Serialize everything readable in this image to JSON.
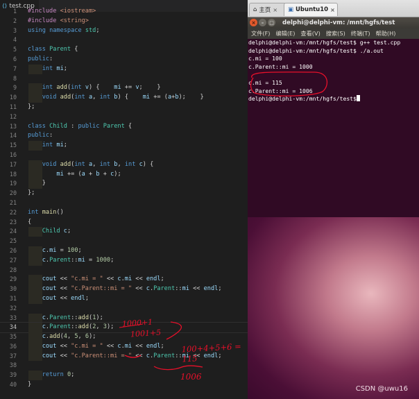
{
  "editor": {
    "tab_label": "test.cpp",
    "tab_icon": "cpp-file-icon",
    "current_line": 34,
    "lines": [
      {
        "n": "1",
        "t": "#include <iostream>"
      },
      {
        "n": "2",
        "t": "#include <string>"
      },
      {
        "n": "3",
        "t": "using namespace std;"
      },
      {
        "n": "4",
        "t": ""
      },
      {
        "n": "5",
        "t": "class Parent {"
      },
      {
        "n": "6",
        "t": "public:"
      },
      {
        "n": "7",
        "t": "    int mi;"
      },
      {
        "n": "8",
        "t": ""
      },
      {
        "n": "9",
        "t": "    int add(int v) {    mi += v;    }"
      },
      {
        "n": "10",
        "t": "    void add(int a, int b) {    mi += (a+b);    }"
      },
      {
        "n": "11",
        "t": "};"
      },
      {
        "n": "12",
        "t": ""
      },
      {
        "n": "13",
        "t": "class Child : public Parent {"
      },
      {
        "n": "14",
        "t": "public:"
      },
      {
        "n": "15",
        "t": "    int mi;"
      },
      {
        "n": "16",
        "t": ""
      },
      {
        "n": "17",
        "t": "    void add(int a, int b, int c) {"
      },
      {
        "n": "18",
        "t": "        mi += (a + b + c);"
      },
      {
        "n": "19",
        "t": "    }"
      },
      {
        "n": "20",
        "t": "};"
      },
      {
        "n": "21",
        "t": ""
      },
      {
        "n": "22",
        "t": "int main()"
      },
      {
        "n": "23",
        "t": "{"
      },
      {
        "n": "24",
        "t": "    Child c;"
      },
      {
        "n": "25",
        "t": ""
      },
      {
        "n": "26",
        "t": "    c.mi = 100;"
      },
      {
        "n": "27",
        "t": "    c.Parent::mi = 1000;"
      },
      {
        "n": "28",
        "t": ""
      },
      {
        "n": "29",
        "t": "    cout << \"c.mi = \" << c.mi << endl;"
      },
      {
        "n": "30",
        "t": "    cout << \"c.Parent::mi = \" << c.Parent::mi << endl;"
      },
      {
        "n": "31",
        "t": "    cout << endl;"
      },
      {
        "n": "32",
        "t": ""
      },
      {
        "n": "33",
        "t": "    c.Parent::add(1);"
      },
      {
        "n": "34",
        "t": "    c.Parent::add(2, 3);"
      },
      {
        "n": "35",
        "t": "    c.add(4, 5, 6);"
      },
      {
        "n": "36",
        "t": "    cout << \"c.mi = \" << c.mi << endl;"
      },
      {
        "n": "37",
        "t": "    cout << \"c.Parent::mi = \" << c.Parent::mi << endl;"
      },
      {
        "n": "38",
        "t": ""
      },
      {
        "n": "39",
        "t": "    return 0;"
      },
      {
        "n": "40",
        "t": "}"
      }
    ]
  },
  "annotations": {
    "a33": "1000+1",
    "a34": "1001+5",
    "a35": "100+4+5+6 = 115",
    "a37": "1006"
  },
  "browser_tabs": {
    "home": {
      "label": "主页",
      "icon": "home-icon"
    },
    "ubuntu": {
      "label": "Ubuntu10",
      "icon": "vm-icon"
    },
    "close_glyph": "×"
  },
  "terminal": {
    "title": "delphi@delphi-vm: /mnt/hgfs/test",
    "menu": [
      "文件(F)",
      "编辑(E)",
      "查看(V)",
      "搜索(S)",
      "终端(T)",
      "帮助(H)"
    ],
    "lines": [
      "delphi@delphi-vm:/mnt/hgfs/test$ g++ test.cpp",
      "delphi@delphi-vm:/mnt/hgfs/test$ ./a.out",
      "c.mi = 100",
      "c.Parent::mi = 1000",
      "",
      "c.mi = 115",
      "c.Parent::mi = 1006",
      "delphi@delphi-vm:/mnt/hgfs/test$"
    ]
  },
  "watermark": "CSDN @uwu16"
}
